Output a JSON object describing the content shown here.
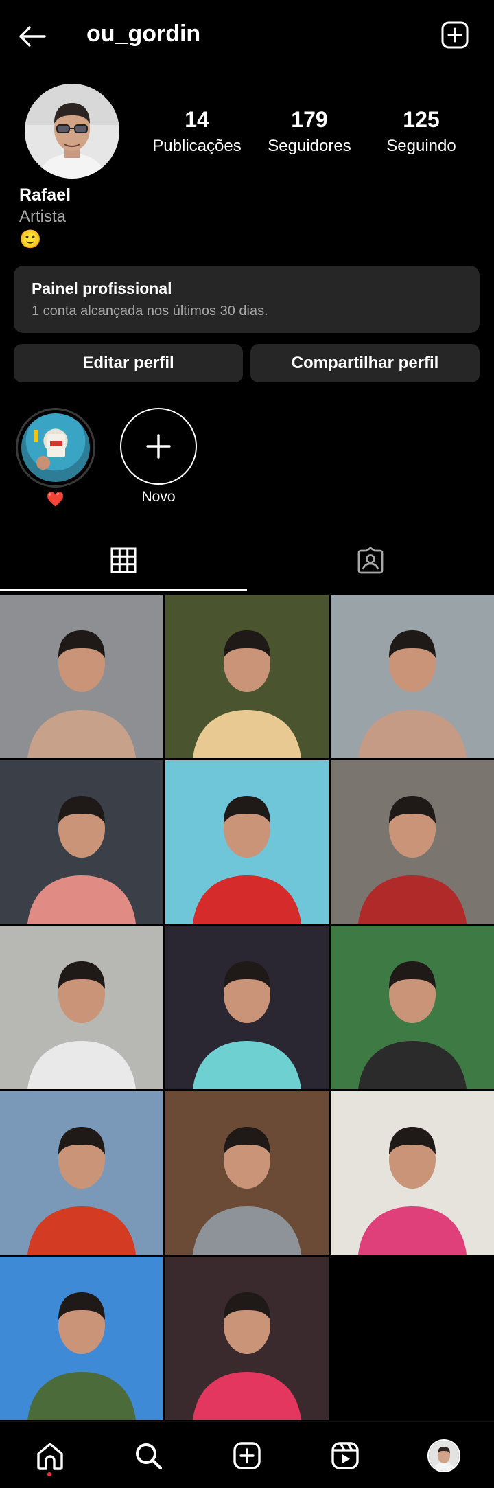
{
  "header": {
    "username": "ou_gordin"
  },
  "profile": {
    "stats": [
      {
        "value": "14",
        "label": "Publicações"
      },
      {
        "value": "179",
        "label": "Seguidores"
      },
      {
        "value": "125",
        "label": "Seguindo"
      }
    ],
    "name": "Rafael",
    "category": "Artista",
    "bio_emoji": "🙂"
  },
  "dashboard": {
    "title": "Painel profissional",
    "subtitle": "1 conta alcançada nos últimos 30 dias."
  },
  "buttons": {
    "edit": "Editar perfil",
    "share": "Compartilhar perfil"
  },
  "highlights": [
    {
      "label": "❤️"
    },
    {
      "label": "Novo"
    }
  ],
  "grid": {
    "posts": [
      {
        "bg": "#8d8f93",
        "accent": "#c7a18a"
      },
      {
        "bg": "#4a5530",
        "accent": "#e8c991"
      },
      {
        "bg": "#9aa3a8",
        "accent": "#c69b86"
      },
      {
        "bg": "#3b3f48",
        "accent": "#e08b84"
      },
      {
        "bg": "#6fc6d9",
        "accent": "#d62b2b"
      },
      {
        "bg": "#7b7570",
        "accent": "#b02a2a"
      },
      {
        "bg": "#b7b7b4",
        "accent": "#e9e9e9"
      },
      {
        "bg": "#2a2733",
        "accent": "#6fd0d1"
      },
      {
        "bg": "#3e7a44",
        "accent": "#2b2b2b"
      },
      {
        "bg": "#7a99b8",
        "accent": "#d43b23"
      },
      {
        "bg": "#6b4a36",
        "accent": "#8e9399"
      },
      {
        "bg": "#e6e2dc",
        "accent": "#e0407a"
      },
      {
        "bg": "#3f8ad6",
        "accent": "#4c6b3a"
      },
      {
        "bg": "#3a2a2e",
        "accent": "#e3375f"
      }
    ]
  },
  "colors": {
    "background": "#000000",
    "surface": "#262626",
    "secondary_text": "#a8a8a8",
    "notification_dot": "#ff3040"
  }
}
